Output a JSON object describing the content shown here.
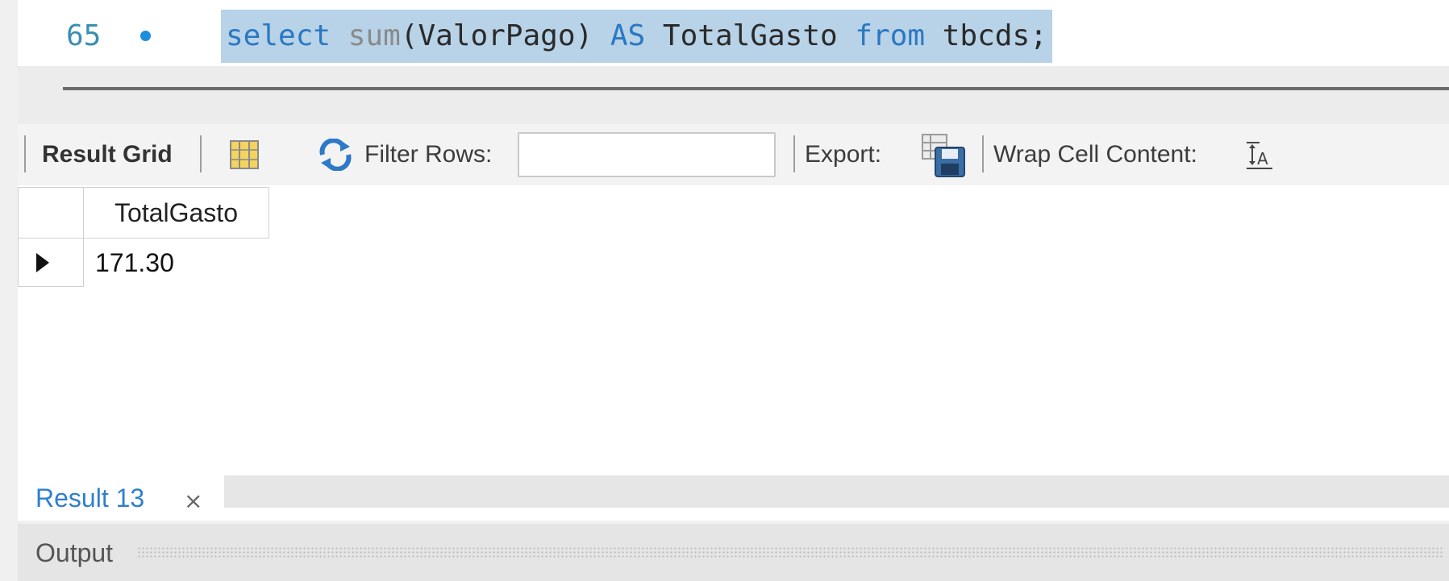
{
  "editor": {
    "line_number": "65",
    "code_tokens": [
      "select",
      "sum",
      "(ValorPago)",
      "AS",
      "TotalGasto",
      "from",
      "tbcds;"
    ]
  },
  "toolbar": {
    "result_grid_label": "Result Grid",
    "filter_rows_label": "Filter Rows:",
    "filter_rows_value": "",
    "export_label": "Export:",
    "wrap_cell_label": "Wrap Cell Content:",
    "icons": [
      "grid-icon",
      "refresh-icon",
      "export-icon",
      "wrap-text-icon"
    ]
  },
  "result_grid": {
    "columns": [
      "TotalGasto"
    ],
    "rows": [
      [
        "171.30"
      ]
    ]
  },
  "result_tab": {
    "label": "Result 13",
    "close_symbol": "×"
  },
  "output": {
    "label": "Output"
  },
  "colors": {
    "selection": "#b8d2e8",
    "keyword": "#2a78c2",
    "tab_text": "#2f7fd0"
  }
}
